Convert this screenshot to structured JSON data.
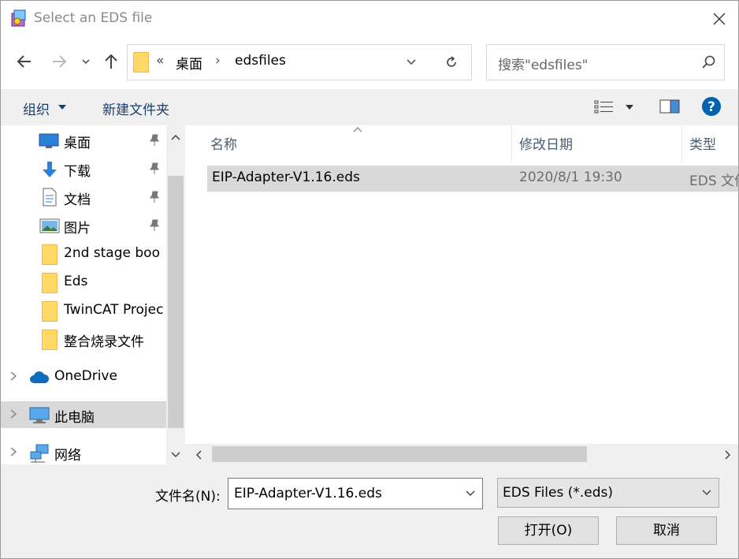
{
  "window": {
    "title": "Select an EDS file",
    "close_symbol": "✕"
  },
  "address": {
    "overflow": "«",
    "crumbs": [
      "桌面",
      "edsfiles"
    ],
    "separator": "›",
    "search_placeholder": "搜索\"edsfiles\""
  },
  "toolbar": {
    "organize_label": "组织",
    "new_folder_label": "新建文件夹"
  },
  "nav": {
    "items": [
      {
        "label": "桌面",
        "icon": "desktop-icon",
        "pinned": true
      },
      {
        "label": "下载",
        "icon": "download-icon",
        "pinned": true
      },
      {
        "label": "文档",
        "icon": "document-icon",
        "pinned": true
      },
      {
        "label": "图片",
        "icon": "pictures-icon",
        "pinned": true
      },
      {
        "label": "2nd stage boo",
        "icon": "folder-icon"
      },
      {
        "label": "Eds",
        "icon": "folder-icon"
      },
      {
        "label": "TwinCAT Projec",
        "icon": "folder-icon"
      },
      {
        "label": "整合烧录文件",
        "icon": "folder-icon"
      },
      {
        "label": "OneDrive",
        "icon": "cloud-icon"
      },
      {
        "label": "此电脑",
        "icon": "computer-icon",
        "selected": true
      },
      {
        "label": "网络",
        "icon": "network-icon"
      }
    ]
  },
  "files": {
    "columns": {
      "name": "名称",
      "date": "修改日期",
      "type": "类型"
    },
    "rows": [
      {
        "name": "EIP-Adapter-V1.16.eds",
        "date": "2020/8/1 19:30",
        "type": "EDS 文件"
      }
    ]
  },
  "footer": {
    "filename_label": "文件名(N):",
    "filename_value": "EIP-Adapter-V1.16.eds",
    "filetype_value": "EDS Files (*.eds)",
    "open_label": "打开(O)",
    "cancel_label": "取消"
  },
  "colors": {
    "accent": "#0063b1",
    "folder": "#ffd867",
    "selection": "#d9d9d9"
  }
}
